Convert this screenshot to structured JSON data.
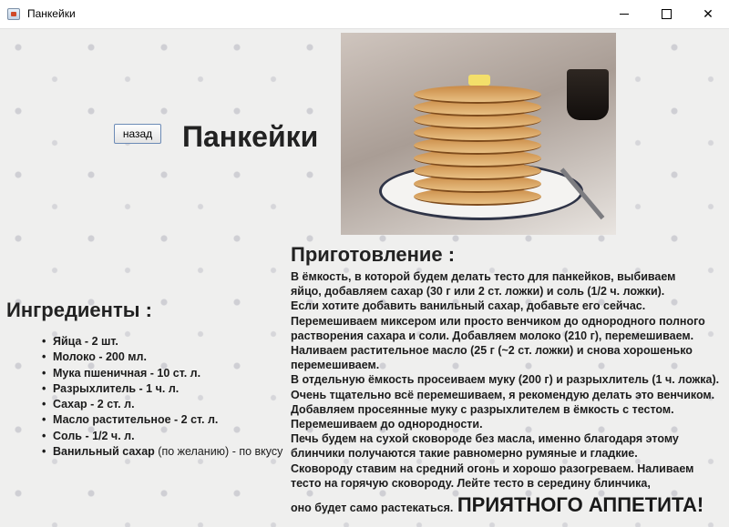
{
  "window": {
    "title": "Панкейки",
    "controls": {
      "minimize": "minimize",
      "maximize": "maximize",
      "close": "✕"
    }
  },
  "header": {
    "back_label": "назад",
    "title": "Панкейки"
  },
  "ingredients": {
    "heading": "Ингредиенты :",
    "items": [
      {
        "text": "Яйца - 2 шт."
      },
      {
        "text": "Молоко - 200 мл."
      },
      {
        "text": "Мука пшеничная - 10 ст. л."
      },
      {
        "text": "Разрыхлитель - 1 ч. л."
      },
      {
        "text": "Сахар - 2 ст. л."
      },
      {
        "text": "Масло растительное - 2 ст. л."
      },
      {
        "text": "Соль - 1/2 ч. л."
      },
      {
        "text": "Ванильный сахар ",
        "note": "(по желанию) - по вкусу"
      }
    ]
  },
  "preparation": {
    "heading": "Приготовление :",
    "lines": [
      "В ёмкость, в которой будем делать тесто для панкейков, выбиваем",
      "яйцо, добавляем сахар (30 г или 2 ст. ложки) и соль (1/2 ч. ложки).",
      "Если хотите добавить ванильный сахар, добавьте его сейчас.",
      "Перемешиваем миксером или просто венчиком до однородного полного",
      "растворения сахара и соли. Добавляем молоко (210 г), перемешиваем.",
      "Наливаем растительное масло (25 г (~2 ст. ложки) и снова хорошенько",
      "перемешиваем.",
      "В отдельную ёмкость просеиваем муку (200 г) и разрыхлитель (1 ч. ложка).",
      "Очень тщательно всё перемешиваем, я рекомендую делать это венчиком.",
      "Добавляем просеянные муку с разрыхлителем в ёмкость с тестом.",
      "Перемешиваем до однородности.",
      "Печь будем на сухой сковороде без масла, именно благодаря этому",
      "блинчики получаются такие равномерно румяные и гладкие.",
      "Сковороду ставим на средний огонь и хорошо разогреваем. Наливаем",
      "тесто на горячую сковороду. Лейте тесто в середину блинчика,"
    ],
    "closing_line": "оно будет само растекаться.",
    "bon_appetit": "ПРИЯТНОГО АППЕТИТА!"
  }
}
